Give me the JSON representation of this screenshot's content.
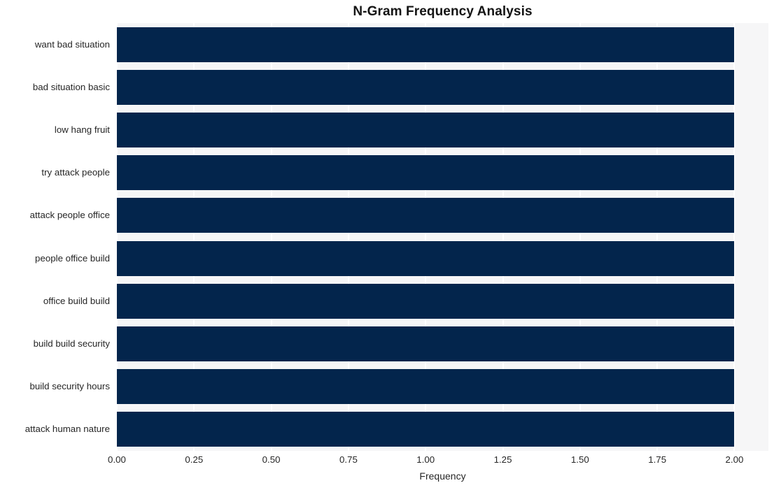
{
  "chart_data": {
    "type": "bar",
    "orientation": "horizontal",
    "title": "N-Gram Frequency Analysis",
    "xlabel": "Frequency",
    "ylabel": "",
    "categories": [
      "want bad situation",
      "bad situation basic",
      "low hang fruit",
      "try attack people",
      "attack people office",
      "people office build",
      "office build build",
      "build build security",
      "build security hours",
      "attack human nature"
    ],
    "values": [
      2,
      2,
      2,
      2,
      2,
      2,
      2,
      2,
      2,
      2
    ],
    "xlim": [
      0.0,
      2.11
    ],
    "xticks": [
      0.0,
      0.25,
      0.5,
      0.75,
      1.0,
      1.25,
      1.5,
      1.75,
      2.0
    ],
    "xtick_labels": [
      "0.00",
      "0.25",
      "0.50",
      "0.75",
      "1.00",
      "1.25",
      "1.50",
      "1.75",
      "2.00"
    ],
    "grid": "vertical-white",
    "legend": null,
    "bar_color": "#03254c",
    "plot_background": "#f6f6f7",
    "figure_background": "#ffffff",
    "text_color": "#262626",
    "title_color": "#141414"
  }
}
